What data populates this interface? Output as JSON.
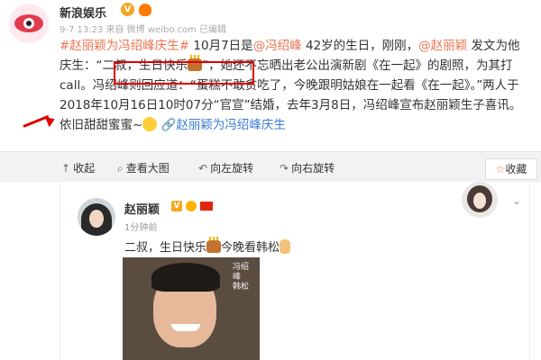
{
  "header": {
    "account_name": "新浪娱乐",
    "verified_badge": "V",
    "meta": "9-7 13:23 来自 微博 weibo.com  已编辑"
  },
  "post": {
    "hashtag": "#赵丽颖为冯绍峰庆生#",
    "seg1": " 10月7日是",
    "mention1": "@冯绍峰",
    "seg2": " 42岁的生日，刚刚，",
    "mention2": "@赵丽颖",
    "seg3": " 发文为他庆生：",
    "quote": "“二叔，生日快乐",
    "quote_end": "”",
    "seg4": "，她还不忘晒出老公出演新剧《在一起》的剧照，为其打call。冯绍峰则回应道：“蛋糕不敢贪吃了，今晚跟明姑娘在一起看《在一起》。”两人于2018年10月16日10时07分“官宣”结婚，去年3月8日，冯绍峰宣布赵丽颖生子喜讯。依旧甜甜蜜蜜~",
    "footer_link": "赵丽颖为冯绍峰庆生",
    "footer_link_icon": "link-icon"
  },
  "toolbar": {
    "collapse": "收起",
    "view_large": "查看大图",
    "rotate_left": "向左旋转",
    "rotate_right": "向右旋转",
    "favorite": "收藏"
  },
  "repost": {
    "name": "赵丽颖",
    "verified_badge": "V",
    "time": "1分钟前",
    "text": "二叔，生日快乐",
    "text_tail": "今晚看韩松",
    "photo_caption": "冯绍峰 韩松"
  },
  "colors": {
    "link_orange": "#eb7350",
    "link_blue": "#3b7bd6",
    "annotation_red": "#e00000",
    "toolbar_bg": "#f2f2f5"
  }
}
